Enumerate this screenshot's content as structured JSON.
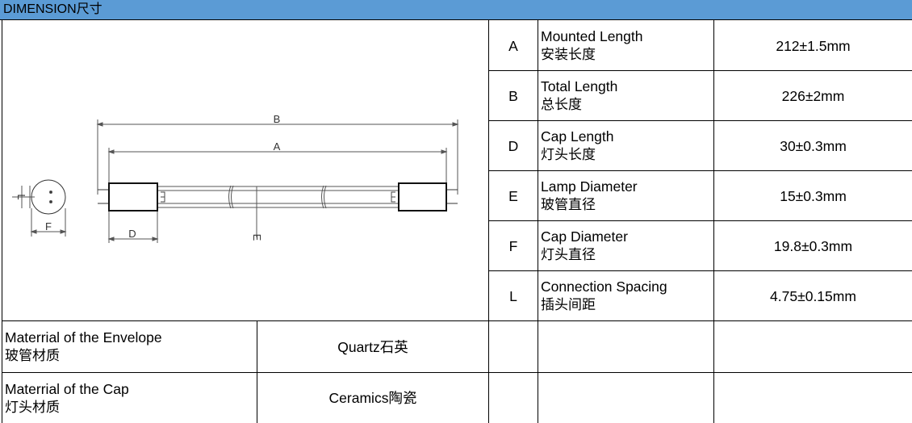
{
  "header": {
    "title": "DIMENSION尺寸"
  },
  "diagram": {
    "labels": {
      "b": "B",
      "a": "A",
      "d": "D",
      "e": "E",
      "f": "F",
      "l": "L"
    }
  },
  "dimensions": [
    {
      "code": "A",
      "name_en": "Mounted Length",
      "name_zh": "安装长度",
      "value": "212±1.5mm"
    },
    {
      "code": "B",
      "name_en": "Total Length",
      "name_zh": "总长度",
      "value": "226±2mm"
    },
    {
      "code": "D",
      "name_en": "Cap Length",
      "name_zh": "灯头长度",
      "value": "30±0.3mm"
    },
    {
      "code": "E",
      "name_en": "Lamp Diameter",
      "name_zh": "玻管直径",
      "value": "15±0.3mm"
    },
    {
      "code": "F",
      "name_en": "Cap Diameter",
      "name_zh": "灯头直径",
      "value": "19.8±0.3mm"
    },
    {
      "code": "L",
      "name_en": "Connection Spacing",
      "name_zh": "插头间距",
      "value": "4.75±0.15mm"
    }
  ],
  "materials": [
    {
      "name_en": "Materrial of the Envelope",
      "name_zh": "玻管材质",
      "value": "Quartz石英"
    },
    {
      "name_en": "Materrial of the Cap",
      "name_zh": "灯头材质",
      "value": "Ceramics陶瓷"
    }
  ]
}
